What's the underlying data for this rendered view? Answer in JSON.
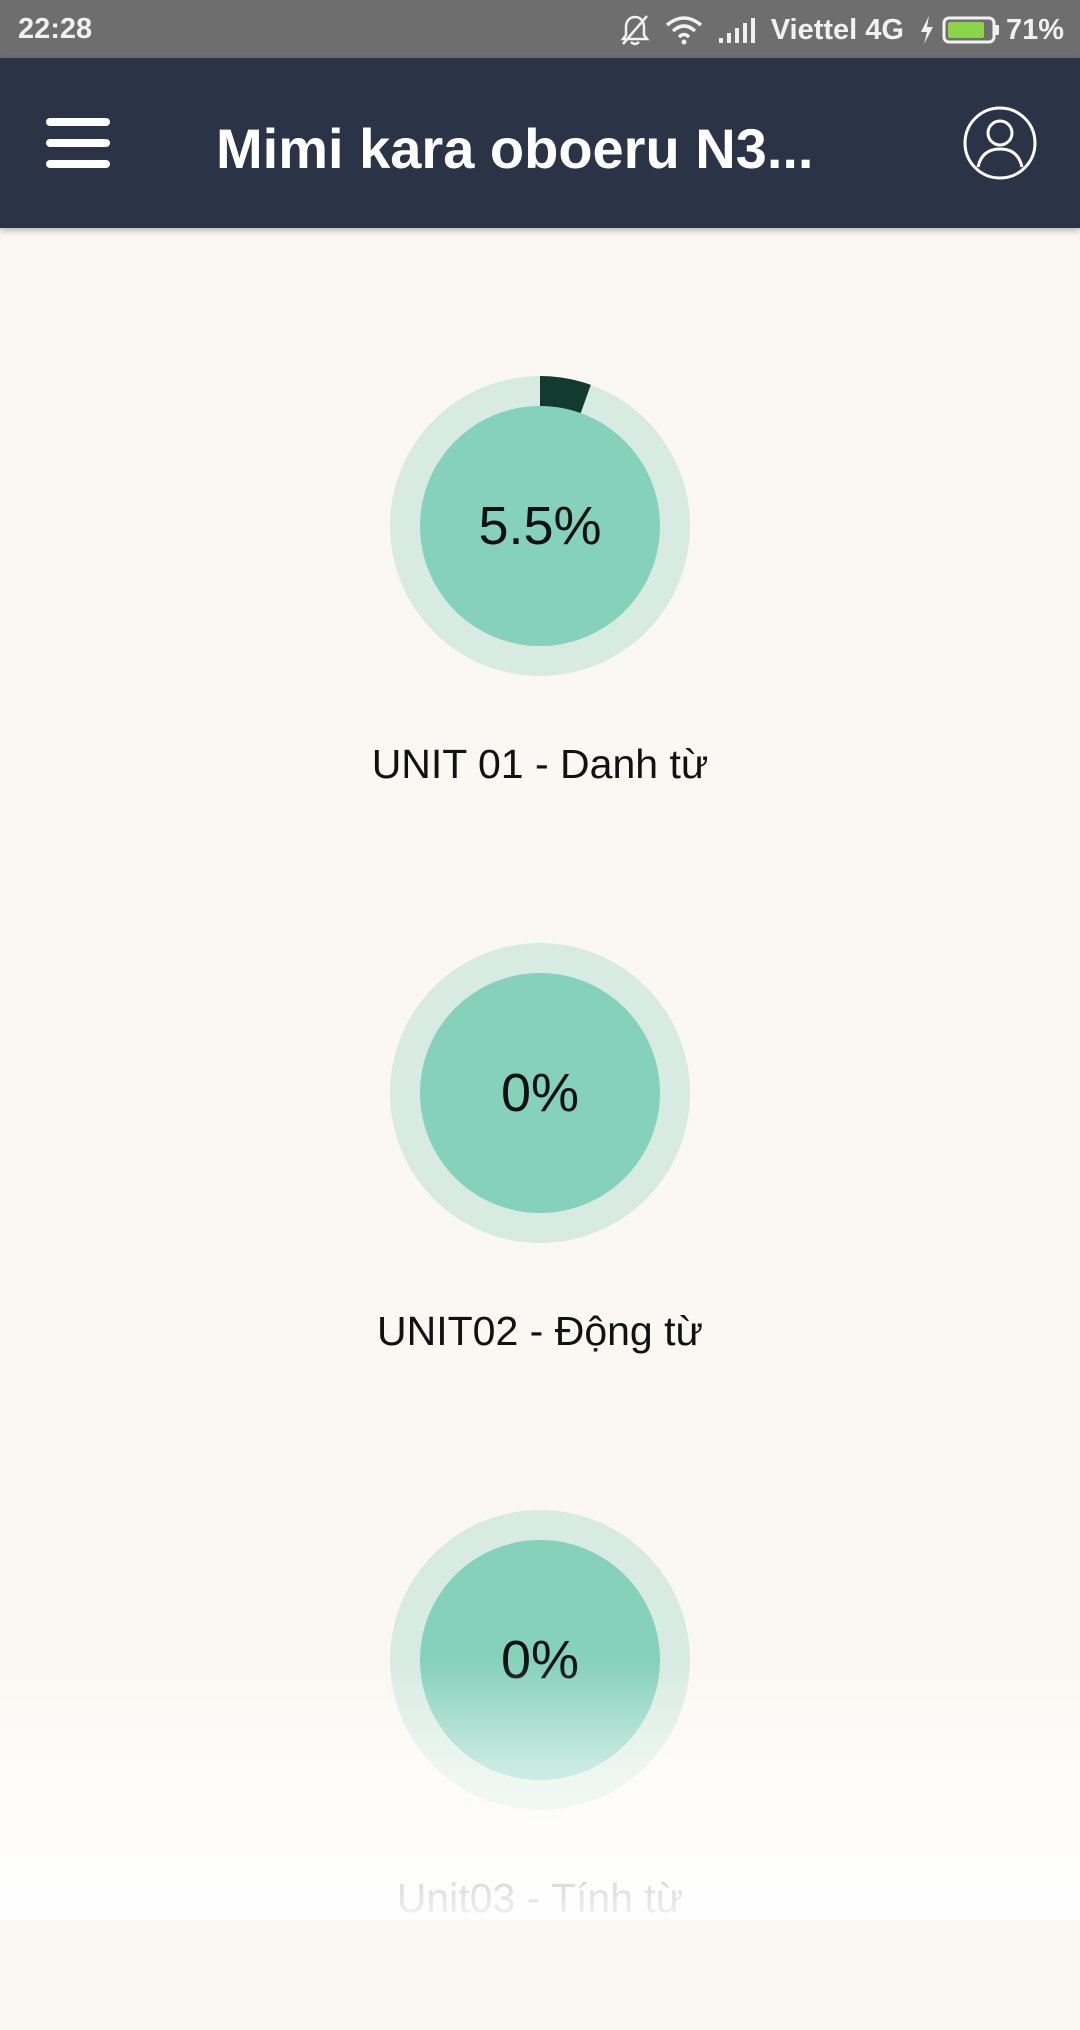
{
  "status_bar": {
    "time": "22:28",
    "carrier": "Viettel 4G",
    "battery_percent": "71%",
    "icons": [
      "bell-off-icon",
      "wifi-icon",
      "signal-icon",
      "charging-icon",
      "battery-icon"
    ]
  },
  "app_bar": {
    "title": "Mimi kara oboeru N3...",
    "menu_icon": "hamburger-menu-icon",
    "profile_icon": "user-profile-icon"
  },
  "colors": {
    "app_bar": "#2a3446",
    "background": "#fbf8f3",
    "ring_track": "#d7ebe1",
    "ring_fill": "#123a2f",
    "circle": "#85d1bc"
  },
  "units": [
    {
      "label": "UNIT 01 - Danh từ",
      "percent_text": "5.5%",
      "progress": 0.055
    },
    {
      "label": "UNIT02 - Động từ",
      "percent_text": "0%",
      "progress": 0
    },
    {
      "label": "Unit03 - Tính từ",
      "percent_text": "0%",
      "progress": 0
    }
  ]
}
